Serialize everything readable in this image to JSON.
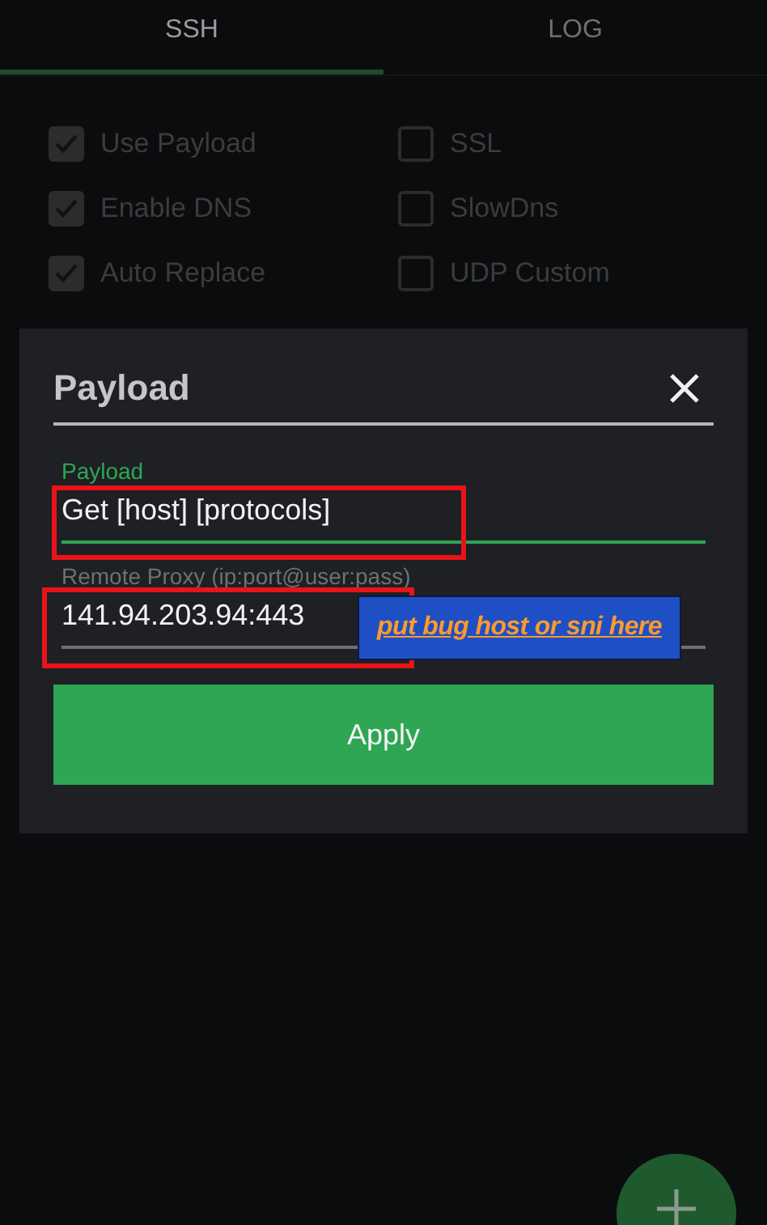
{
  "tabs": [
    {
      "label": "SSH",
      "selected": true
    },
    {
      "label": "LOG",
      "selected": false
    }
  ],
  "options": [
    {
      "label": "Use Payload",
      "checked": true
    },
    {
      "label": "SSL",
      "checked": false
    },
    {
      "label": "Enable DNS",
      "checked": true
    },
    {
      "label": "SlowDns",
      "checked": false
    },
    {
      "label": "Auto Replace",
      "checked": true
    },
    {
      "label": "UDP Custom",
      "checked": false
    }
  ],
  "dialog": {
    "title": "Payload",
    "fields": [
      {
        "label": "Payload",
        "value": "Get [host] [protocols]",
        "focused": true
      },
      {
        "label": "Remote Proxy (ip:port@user:pass)",
        "value": "141.94.203.94:443",
        "focused": false
      }
    ],
    "button": "Apply"
  },
  "annotation": {
    "note": "put bug host or sni here"
  }
}
